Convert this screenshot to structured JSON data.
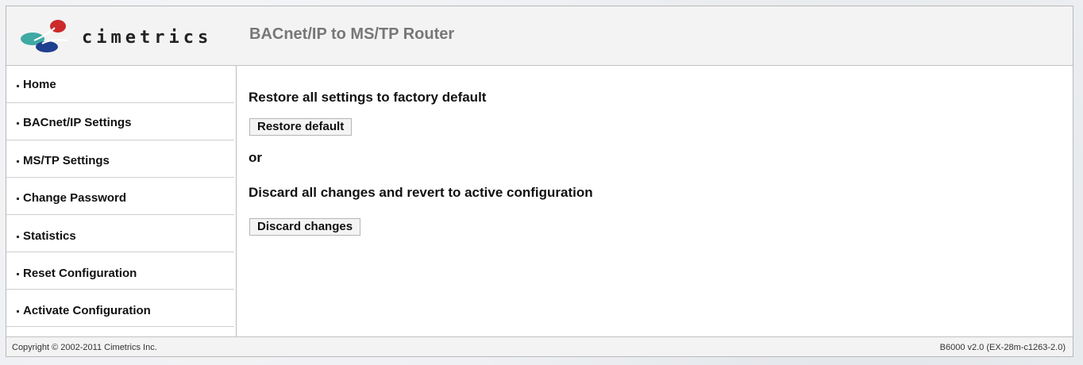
{
  "header": {
    "logo_text": "cimetrics",
    "title": "BACnet/IP to MS/TP Router"
  },
  "sidebar": {
    "items": [
      {
        "label": "Home"
      },
      {
        "label": "BACnet/IP Settings"
      },
      {
        "label": "MS/TP Settings"
      },
      {
        "label": "Change Password"
      },
      {
        "label": "Statistics"
      },
      {
        "label": "Reset Configuration"
      },
      {
        "label": "Activate Configuration"
      }
    ]
  },
  "main": {
    "restore_heading": "Restore all settings to factory default",
    "restore_button": "Restore default",
    "or_text": "or",
    "discard_heading": "Discard all changes and revert to active configuration",
    "discard_button": "Discard changes"
  },
  "footer": {
    "copyright": "Copyright © 2002-2011 Cimetrics Inc.",
    "version": "B6000 v2.0 (EX-28m-c1263-2.0)"
  },
  "colors": {
    "header_bg": "#f3f3f3",
    "title_text": "#777777",
    "logo_blue": "#1f3f8f",
    "logo_red": "#cc2a2a",
    "logo_teal": "#3fa9a4"
  }
}
